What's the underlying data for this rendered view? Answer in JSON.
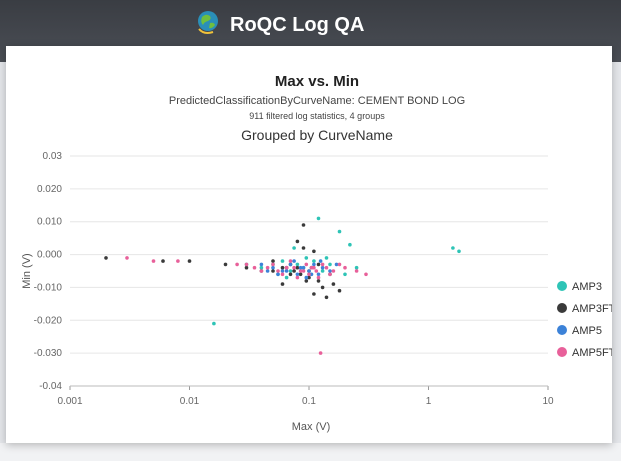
{
  "app": {
    "title": "RoQC Log QA",
    "logo_icon": "globe-logo-icon"
  },
  "colors": {
    "header": "#3f4248",
    "AMP3": "#2ec4b6",
    "AMP3FT": "#3a3a3a",
    "AMP5": "#3c82d8",
    "AMP5FT": "#e8609a"
  },
  "chart_data": {
    "type": "scatter",
    "title": "Max vs. Min",
    "subtitle": "PredictedClassificationByCurveName: CEMENT BOND LOG",
    "note": "911 filtered log statistics, 4 groups",
    "group_title": "Grouped by CurveName",
    "xlabel": "Max (V)",
    "ylabel": "Min (V)",
    "x_scale": "log",
    "xlim": [
      0.001,
      10
    ],
    "ylim": [
      -0.04,
      0.03
    ],
    "x_ticks": [
      "0.001",
      "0.01",
      "0.1",
      "1",
      "10"
    ],
    "y_ticks": [
      "0.03",
      "0.020",
      "0.010",
      "0.000",
      "-0.010",
      "-0.020",
      "-0.030",
      "-0.04"
    ],
    "legend_position": "right",
    "grid": true,
    "series": [
      {
        "name": "AMP3",
        "color": "#2ec4b6",
        "points": [
          [
            0.016,
            -0.021
          ],
          [
            1.6,
            0.002
          ],
          [
            1.8,
            0.001
          ],
          [
            0.12,
            0.011
          ],
          [
            0.18,
            0.007
          ],
          [
            0.05,
            -0.003
          ],
          [
            0.06,
            -0.002
          ],
          [
            0.07,
            -0.005
          ],
          [
            0.09,
            -0.004
          ],
          [
            0.1,
            -0.006
          ],
          [
            0.14,
            -0.001
          ],
          [
            0.22,
            0.003
          ],
          [
            0.04,
            -0.004
          ],
          [
            0.08,
            -0.003
          ],
          [
            0.11,
            -0.002
          ],
          [
            0.25,
            -0.004
          ],
          [
            0.03,
            -0.003
          ],
          [
            0.065,
            -0.007
          ],
          [
            0.095,
            -0.001
          ],
          [
            0.15,
            -0.003
          ],
          [
            0.2,
            -0.006
          ],
          [
            0.055,
            -0.006
          ],
          [
            0.075,
            0.002
          ],
          [
            0.13,
            -0.005
          ]
        ]
      },
      {
        "name": "AMP3FT",
        "color": "#3a3a3a",
        "points": [
          [
            0.002,
            -0.001
          ],
          [
            0.006,
            -0.002
          ],
          [
            0.01,
            -0.002
          ],
          [
            0.02,
            -0.003
          ],
          [
            0.03,
            -0.004
          ],
          [
            0.05,
            -0.005
          ],
          [
            0.06,
            -0.004
          ],
          [
            0.07,
            -0.006
          ],
          [
            0.08,
            -0.004
          ],
          [
            0.09,
            0.009
          ],
          [
            0.1,
            -0.005
          ],
          [
            0.11,
            -0.012
          ],
          [
            0.12,
            -0.008
          ],
          [
            0.13,
            -0.01
          ],
          [
            0.14,
            -0.013
          ],
          [
            0.15,
            -0.006
          ],
          [
            0.16,
            -0.009
          ],
          [
            0.18,
            -0.011
          ],
          [
            0.08,
            0.004
          ],
          [
            0.09,
            0.002
          ],
          [
            0.1,
            -0.007
          ],
          [
            0.07,
            -0.003
          ],
          [
            0.06,
            -0.009
          ],
          [
            0.12,
            -0.003
          ],
          [
            0.11,
            0.001
          ],
          [
            0.085,
            -0.006
          ],
          [
            0.095,
            -0.008
          ],
          [
            0.05,
            -0.002
          ],
          [
            0.04,
            -0.005
          ],
          [
            0.075,
            -0.005
          ],
          [
            0.065,
            -0.004
          ],
          [
            0.105,
            -0.004
          ]
        ]
      },
      {
        "name": "AMP5",
        "color": "#3c82d8",
        "points": [
          [
            0.04,
            -0.003
          ],
          [
            0.05,
            -0.004
          ],
          [
            0.06,
            -0.005
          ],
          [
            0.07,
            -0.003
          ],
          [
            0.08,
            -0.006
          ],
          [
            0.09,
            -0.004
          ],
          [
            0.1,
            -0.005
          ],
          [
            0.11,
            -0.003
          ],
          [
            0.12,
            -0.006
          ],
          [
            0.13,
            -0.004
          ],
          [
            0.15,
            -0.005
          ],
          [
            0.17,
            -0.003
          ],
          [
            0.055,
            -0.006
          ],
          [
            0.075,
            -0.002
          ],
          [
            0.095,
            -0.007
          ],
          [
            0.085,
            -0.004
          ],
          [
            0.065,
            -0.005
          ],
          [
            0.105,
            -0.006
          ],
          [
            0.125,
            -0.002
          ],
          [
            0.045,
            -0.005
          ]
        ]
      },
      {
        "name": "AMP5FT",
        "color": "#e8609a",
        "points": [
          [
            0.003,
            -0.001
          ],
          [
            0.005,
            -0.002
          ],
          [
            0.008,
            -0.002
          ],
          [
            0.025,
            -0.003
          ],
          [
            0.035,
            -0.004
          ],
          [
            0.045,
            -0.004
          ],
          [
            0.055,
            -0.005
          ],
          [
            0.065,
            -0.004
          ],
          [
            0.075,
            -0.004
          ],
          [
            0.085,
            -0.005
          ],
          [
            0.095,
            -0.003
          ],
          [
            0.105,
            -0.004
          ],
          [
            0.115,
            -0.005
          ],
          [
            0.125,
            -0.03
          ],
          [
            0.14,
            -0.004
          ],
          [
            0.16,
            -0.005
          ],
          [
            0.2,
            -0.004
          ],
          [
            0.25,
            -0.005
          ],
          [
            0.3,
            -0.006
          ],
          [
            0.05,
            -0.003
          ],
          [
            0.06,
            -0.006
          ],
          [
            0.07,
            -0.002
          ],
          [
            0.08,
            -0.007
          ],
          [
            0.09,
            -0.005
          ],
          [
            0.1,
            -0.006
          ],
          [
            0.11,
            -0.004
          ],
          [
            0.13,
            -0.003
          ],
          [
            0.15,
            -0.006
          ],
          [
            0.04,
            -0.005
          ],
          [
            0.03,
            -0.003
          ],
          [
            0.12,
            -0.007
          ],
          [
            0.18,
            -0.003
          ]
        ]
      }
    ]
  }
}
